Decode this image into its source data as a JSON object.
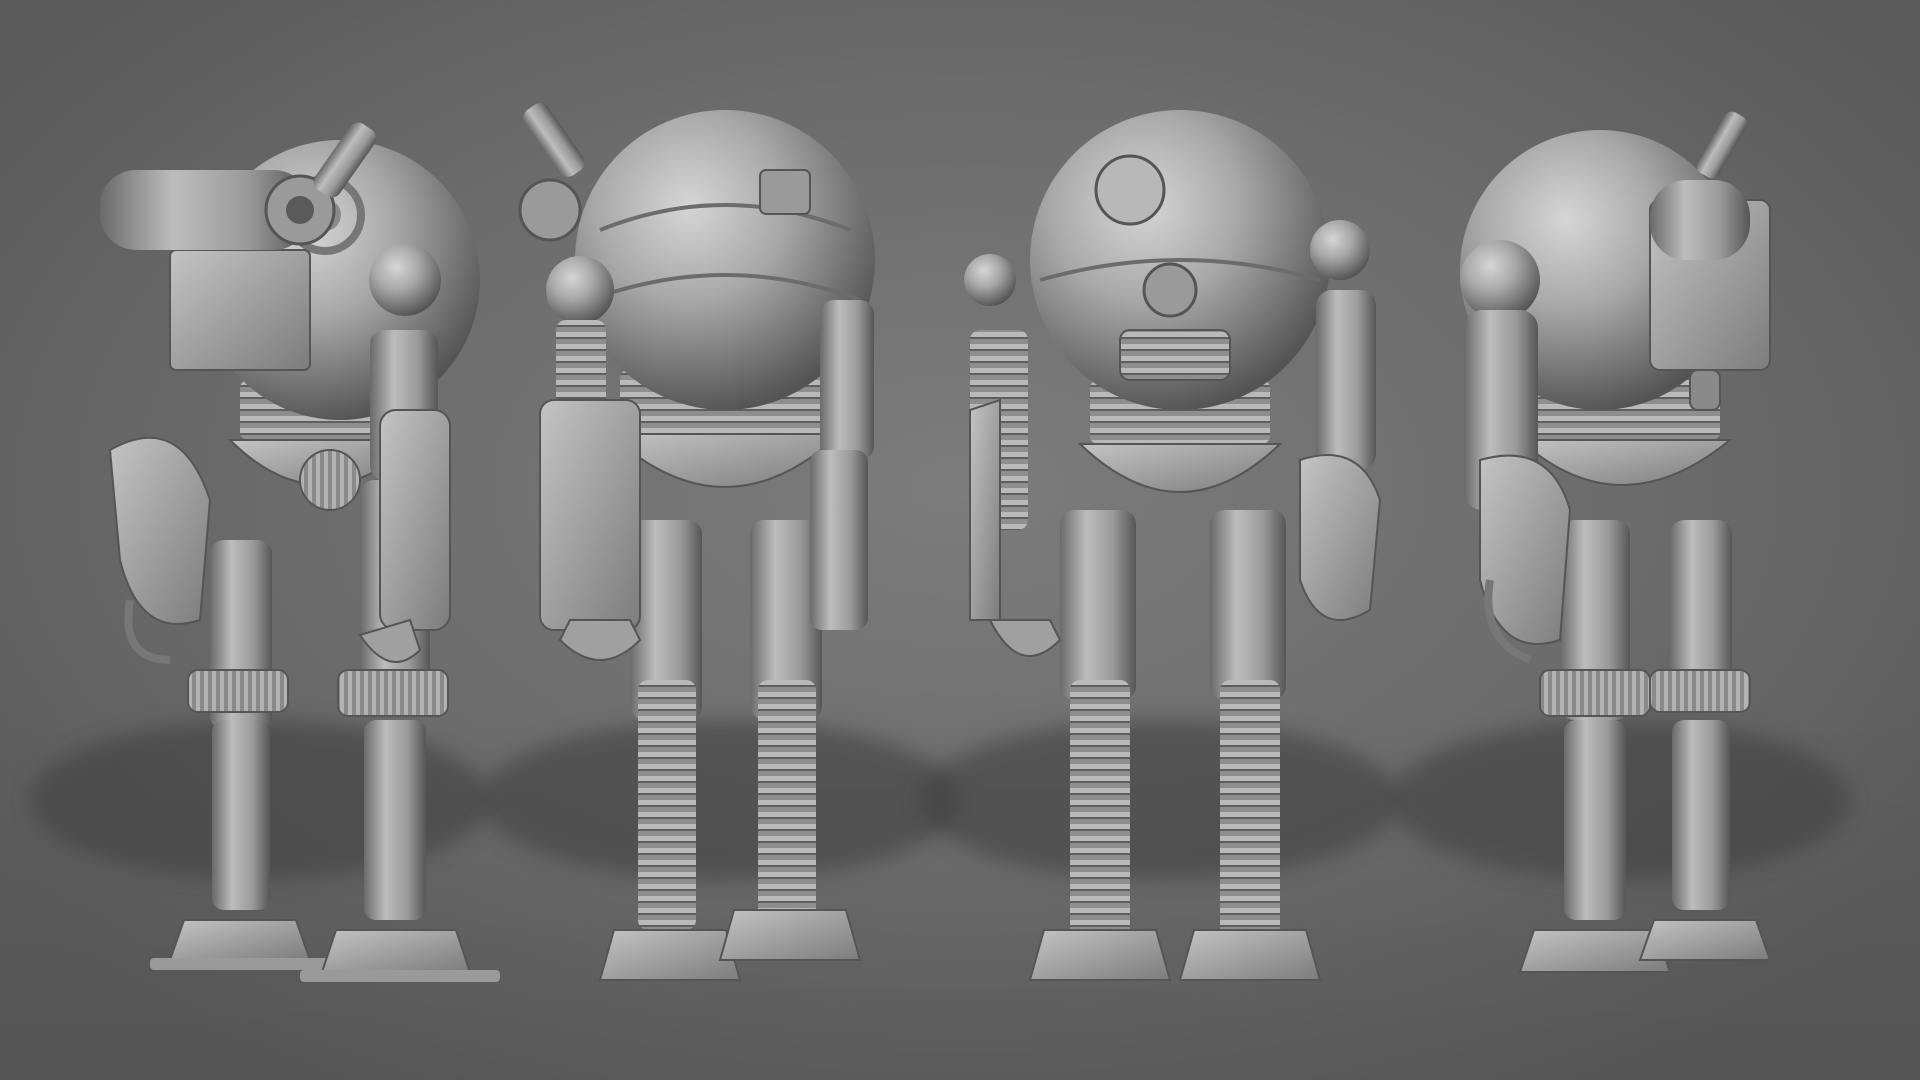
{
  "scene": {
    "background_color": "#6c6c6c",
    "model_color": "#a9a9a9",
    "shadow_color": "#3e3e3e"
  },
  "views": [
    {
      "name": "left-side-view",
      "facing": "left"
    },
    {
      "name": "back-view",
      "facing": "back"
    },
    {
      "name": "front-view",
      "facing": "front"
    },
    {
      "name": "right-side-view",
      "facing": "right"
    }
  ]
}
